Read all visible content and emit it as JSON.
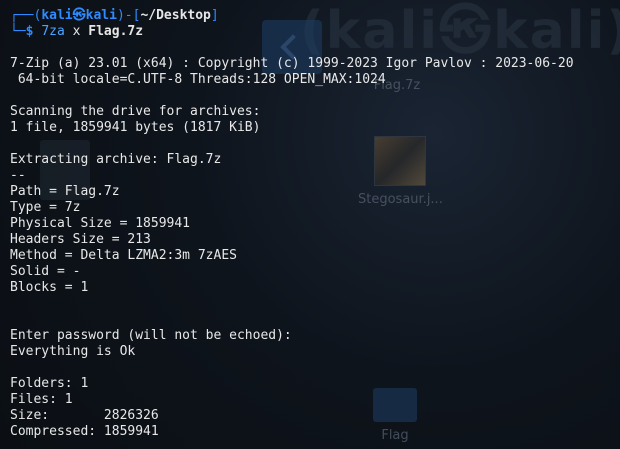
{
  "prompt": {
    "box_top": "┌──(",
    "user": "kali",
    "at": "㉿",
    "host": "kali",
    "separator": ")-[",
    "path": "~/Desktop",
    "close": "]",
    "box_bottom": "└─",
    "dollar": "$",
    "command_program": "7za",
    "command_args": " x ",
    "command_file": "Flag.7z"
  },
  "desktop": {
    "watermark": "(kali㉿kali)",
    "icons": [
      {
        "label": "Flag.7z",
        "icon": "archive-file-icon"
      },
      {
        "label": "Stegosaur.j...",
        "icon": "image-file-icon"
      },
      {
        "label": "Flag",
        "icon": "folder-icon"
      }
    ]
  },
  "output_lines": [
    "7-Zip (a) 23.01 (x64) : Copyright (c) 1999-2023 Igor Pavlov : 2023-06-20",
    " 64-bit locale=C.UTF-8 Threads:128 OPEN_MAX:1024",
    "",
    "Scanning the drive for archives:",
    "1 file, 1859941 bytes (1817 KiB)",
    "",
    "Extracting archive: Flag.7z",
    "--",
    "Path = Flag.7z",
    "Type = 7z",
    "Physical Size = 1859941",
    "Headers Size = 213",
    "Method = Delta LZMA2:3m 7zAES",
    "Solid = -",
    "Blocks = 1",
    "",
    "",
    "Enter password (will not be echoed):",
    "Everything is Ok",
    "",
    "Folders: 1",
    "Files: 1",
    "Size:       2826326",
    "Compressed: 1859941"
  ],
  "colors": {
    "background": "#0b0f14",
    "prompt_blue": "#2e8bff",
    "text": "#e8e8e8"
  }
}
